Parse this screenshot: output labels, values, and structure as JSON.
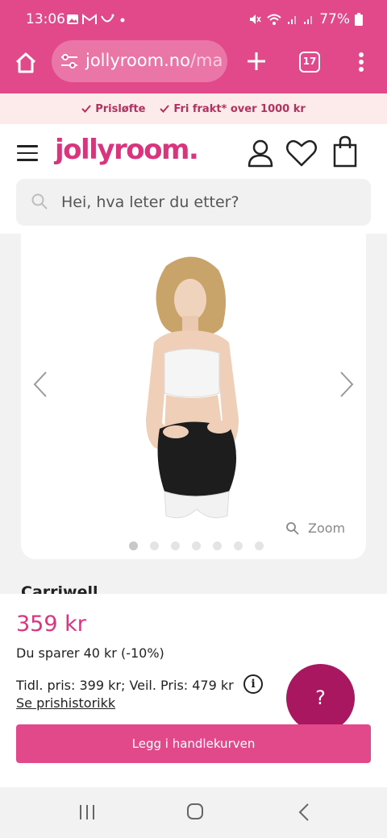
{
  "status_bar": {
    "time": "13:06",
    "battery": "77%",
    "left_icons": [
      "image-icon",
      "gmail-icon",
      "smile-icon",
      "dot-icon"
    ],
    "right_icons": [
      "mute-icon",
      "wifi-icon",
      "signal-icon",
      "signal-icon",
      "battery-icon"
    ]
  },
  "browser": {
    "url_main": "jollyroom.no",
    "url_rest": "/ma",
    "tab_count": "17"
  },
  "promo": {
    "item1": "Prisløfte",
    "item2": "Fri frakt* over 1000 kr"
  },
  "header": {
    "logo": "jollyroom.",
    "search_placeholder": "Hei, hva leter du etter?"
  },
  "gallery": {
    "zoom_label": "Zoom",
    "image_count": 7,
    "active_index": 0
  },
  "product": {
    "brand": "Carriwell",
    "price": "359 kr",
    "saving": "Du sparer 40 kr (-10%)",
    "prev_price": "Tidl. pris: 399 kr;  Veil. Pris: 479 kr",
    "history_link": "Se prishistorikk",
    "add_to_cart": "Legg i handlekurven"
  },
  "help": {
    "label": "?"
  },
  "colors": {
    "brand_pink": "#e2498a",
    "logo_pink": "#d9357f",
    "help_button": "#a8175f"
  }
}
